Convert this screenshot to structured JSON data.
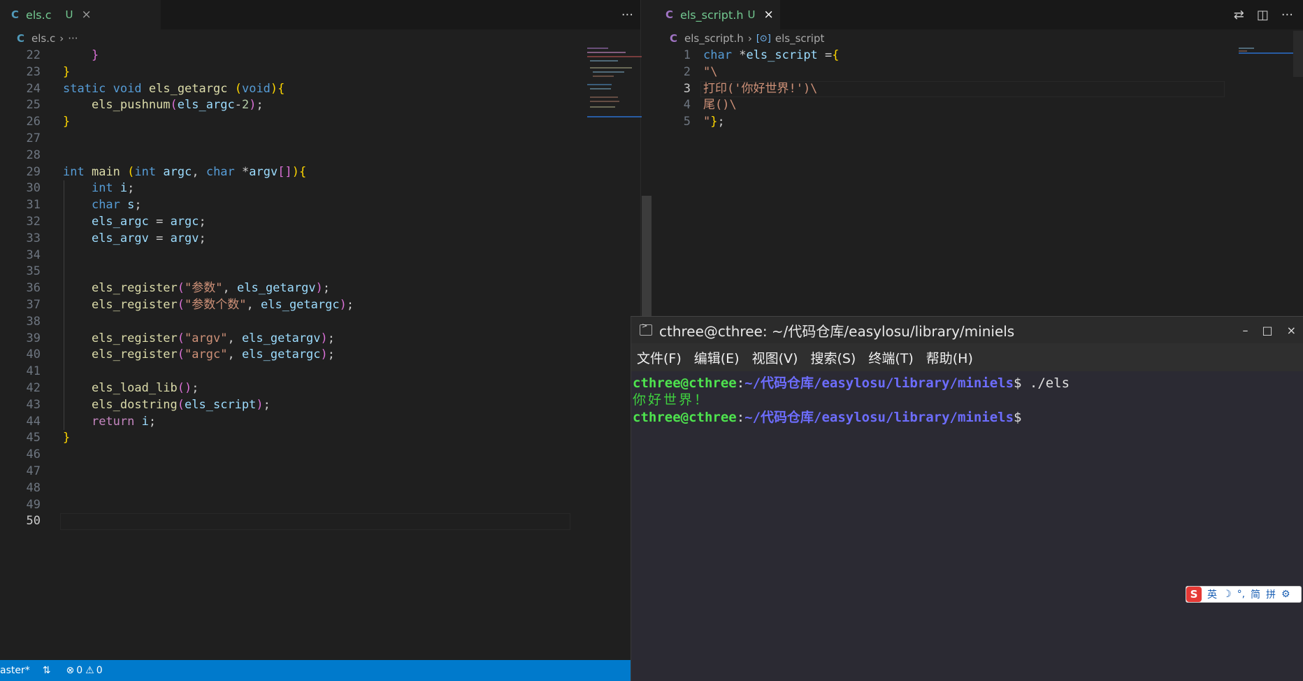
{
  "left_editor": {
    "tab": {
      "icon": "c-file-icon",
      "title": "els.c",
      "status": "U",
      "close": "×"
    },
    "more_actions": "···",
    "breadcrumb": {
      "file": "els.c",
      "sep": "›",
      "more": "···"
    },
    "lines": [
      {
        "n": "22",
        "tokens": [
          [
            "    ",
            "p"
          ],
          [
            "}",
            "br2"
          ]
        ]
      },
      {
        "n": "23",
        "tokens": [
          [
            "}",
            "br1"
          ]
        ]
      },
      {
        "n": "24",
        "tokens": [
          [
            "static",
            "kw"
          ],
          [
            " ",
            "p"
          ],
          [
            "void",
            "kw"
          ],
          [
            " ",
            "p"
          ],
          [
            "els_getargc",
            "fn"
          ],
          [
            " ",
            "p"
          ],
          [
            "(",
            "br1"
          ],
          [
            "void",
            "kw"
          ],
          [
            ")",
            "br1"
          ],
          [
            "{",
            "br1"
          ]
        ]
      },
      {
        "n": "25",
        "tokens": [
          [
            "    ",
            "p"
          ],
          [
            "els_pushnum",
            "fn"
          ],
          [
            "(",
            "br2"
          ],
          [
            "els_argc",
            "var"
          ],
          [
            "-",
            "p"
          ],
          [
            "2",
            "num"
          ],
          [
            ")",
            "br2"
          ],
          [
            ";",
            "p"
          ]
        ]
      },
      {
        "n": "26",
        "tokens": [
          [
            "}",
            "br1"
          ]
        ]
      },
      {
        "n": "27",
        "tokens": []
      },
      {
        "n": "28",
        "tokens": []
      },
      {
        "n": "29",
        "tokens": [
          [
            "int",
            "kw"
          ],
          [
            " ",
            "p"
          ],
          [
            "main",
            "fn"
          ],
          [
            " ",
            "p"
          ],
          [
            "(",
            "br1"
          ],
          [
            "int",
            "kw"
          ],
          [
            " ",
            "p"
          ],
          [
            "argc",
            "var"
          ],
          [
            ", ",
            "p"
          ],
          [
            "char",
            "kw"
          ],
          [
            " *",
            "p"
          ],
          [
            "argv",
            "var"
          ],
          [
            "[]",
            "br2"
          ],
          [
            ")",
            "br1"
          ],
          [
            "{",
            "br1"
          ]
        ]
      },
      {
        "n": "30",
        "tokens": [
          [
            "    ",
            "p"
          ],
          [
            "int",
            "kw"
          ],
          [
            " ",
            "p"
          ],
          [
            "i",
            "var"
          ],
          [
            ";",
            "p"
          ]
        ]
      },
      {
        "n": "31",
        "tokens": [
          [
            "    ",
            "p"
          ],
          [
            "char",
            "kw"
          ],
          [
            " ",
            "p"
          ],
          [
            "s",
            "var"
          ],
          [
            ";",
            "p"
          ]
        ]
      },
      {
        "n": "32",
        "tokens": [
          [
            "    ",
            "p"
          ],
          [
            "els_argc",
            "var"
          ],
          [
            " = ",
            "p"
          ],
          [
            "argc",
            "var"
          ],
          [
            ";",
            "p"
          ]
        ]
      },
      {
        "n": "33",
        "tokens": [
          [
            "    ",
            "p"
          ],
          [
            "els_argv",
            "var"
          ],
          [
            " = ",
            "p"
          ],
          [
            "argv",
            "var"
          ],
          [
            ";",
            "p"
          ]
        ]
      },
      {
        "n": "34",
        "tokens": []
      },
      {
        "n": "35",
        "tokens": []
      },
      {
        "n": "36",
        "tokens": [
          [
            "    ",
            "p"
          ],
          [
            "els_register",
            "fn"
          ],
          [
            "(",
            "br2"
          ],
          [
            "\"参数\"",
            "str"
          ],
          [
            ", ",
            "p"
          ],
          [
            "els_getargv",
            "var"
          ],
          [
            ")",
            "br2"
          ],
          [
            ";",
            "p"
          ]
        ]
      },
      {
        "n": "37",
        "tokens": [
          [
            "    ",
            "p"
          ],
          [
            "els_register",
            "fn"
          ],
          [
            "(",
            "br2"
          ],
          [
            "\"参数个数\"",
            "str"
          ],
          [
            ", ",
            "p"
          ],
          [
            "els_getargc",
            "var"
          ],
          [
            ")",
            "br2"
          ],
          [
            ";",
            "p"
          ]
        ]
      },
      {
        "n": "38",
        "tokens": []
      },
      {
        "n": "39",
        "tokens": [
          [
            "    ",
            "p"
          ],
          [
            "els_register",
            "fn"
          ],
          [
            "(",
            "br2"
          ],
          [
            "\"argv\"",
            "str"
          ],
          [
            ", ",
            "p"
          ],
          [
            "els_getargv",
            "var"
          ],
          [
            ")",
            "br2"
          ],
          [
            ";",
            "p"
          ]
        ]
      },
      {
        "n": "40",
        "tokens": [
          [
            "    ",
            "p"
          ],
          [
            "els_register",
            "fn"
          ],
          [
            "(",
            "br2"
          ],
          [
            "\"argc\"",
            "str"
          ],
          [
            ", ",
            "p"
          ],
          [
            "els_getargc",
            "var"
          ],
          [
            ")",
            "br2"
          ],
          [
            ";",
            "p"
          ]
        ]
      },
      {
        "n": "41",
        "tokens": []
      },
      {
        "n": "42",
        "tokens": [
          [
            "    ",
            "p"
          ],
          [
            "els_load_lib",
            "fn"
          ],
          [
            "()",
            "br2"
          ],
          [
            ";",
            "p"
          ]
        ]
      },
      {
        "n": "43",
        "tokens": [
          [
            "    ",
            "p"
          ],
          [
            "els_dostring",
            "fn"
          ],
          [
            "(",
            "br2"
          ],
          [
            "els_script",
            "var"
          ],
          [
            ")",
            "br2"
          ],
          [
            ";",
            "p"
          ]
        ]
      },
      {
        "n": "44",
        "tokens": [
          [
            "    ",
            "p"
          ],
          [
            "return",
            "ctl"
          ],
          [
            " ",
            "p"
          ],
          [
            "i",
            "var"
          ],
          [
            ";",
            "p"
          ]
        ]
      },
      {
        "n": "45",
        "tokens": [
          [
            "}",
            "br1"
          ]
        ]
      },
      {
        "n": "46",
        "tokens": []
      },
      {
        "n": "47",
        "tokens": []
      },
      {
        "n": "48",
        "tokens": []
      },
      {
        "n": "49",
        "tokens": []
      },
      {
        "n": "50",
        "tokens": []
      }
    ],
    "current_line": "50"
  },
  "right_editor": {
    "tab": {
      "icon": "c-header-icon",
      "title": "els_script.h",
      "status": "U",
      "close": "×"
    },
    "actions": {
      "compare": "⇄",
      "split": "◫",
      "more": "···"
    },
    "breadcrumb": {
      "file": "els_script.h",
      "sep": "›",
      "symbol": "els_script"
    },
    "lines": [
      {
        "n": "1",
        "tokens": [
          [
            "char",
            "kw"
          ],
          [
            " *",
            "p"
          ],
          [
            "els_script",
            "var"
          ],
          [
            " =",
            "p"
          ],
          [
            "{",
            "br1"
          ]
        ]
      },
      {
        "n": "2",
        "tokens": [
          [
            "\"\\",
            "str"
          ]
        ]
      },
      {
        "n": "3",
        "tokens": [
          [
            "打印('你好世界!')\\",
            "str"
          ]
        ]
      },
      {
        "n": "4",
        "tokens": [
          [
            "尾()\\",
            "str"
          ]
        ]
      },
      {
        "n": "5",
        "tokens": [
          [
            "\"",
            "str"
          ],
          [
            "}",
            "br1"
          ],
          [
            ";",
            "p"
          ]
        ]
      }
    ],
    "current_line": "3"
  },
  "statusbar": {
    "branch": "aster*",
    "sync_icon": "sync-icon",
    "errors": "0",
    "warnings": "0"
  },
  "terminal": {
    "title": "cthree@cthree: ~/代码仓库/easylosu/library/miniels",
    "window_controls": {
      "minimize": "–",
      "maximize": "□",
      "close": "×"
    },
    "menu": [
      "文件(F)",
      "编辑(E)",
      "视图(V)",
      "搜索(S)",
      "终端(T)",
      "帮助(H)"
    ],
    "lines": [
      {
        "user": "cthree@cthree",
        "colon": ":",
        "path": "~/代码仓库/easylosu/library/miniels",
        "prompt": "$ ",
        "cmd": "./els"
      },
      {
        "output": "你好世界！"
      },
      {
        "user": "cthree@cthree",
        "colon": ":",
        "path": "~/代码仓库/easylosu/library/miniels",
        "prompt": "$",
        "cmd": ""
      }
    ]
  },
  "ime": {
    "logo": "S",
    "items": [
      "英",
      "☽",
      "°,",
      "简",
      "拼",
      "⚙"
    ]
  }
}
